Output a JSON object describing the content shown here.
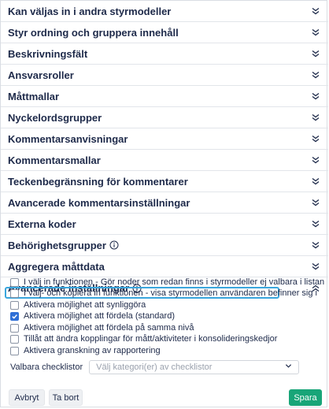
{
  "accordion": [
    {
      "label": "Kan väljas in i andra styrmodeller",
      "expanded": false,
      "info": false
    },
    {
      "label": "Styr ordning och gruppera innehåll",
      "expanded": false,
      "info": false
    },
    {
      "label": "Beskrivningsfält",
      "expanded": false,
      "info": false
    },
    {
      "label": "Ansvarsroller",
      "expanded": false,
      "info": false
    },
    {
      "label": "Måttmallar",
      "expanded": false,
      "info": false
    },
    {
      "label": "Nyckelordsgrupper",
      "expanded": false,
      "info": false
    },
    {
      "label": "Kommentarsanvisningar",
      "expanded": false,
      "info": false
    },
    {
      "label": "Kommentarsmallar",
      "expanded": false,
      "info": false
    },
    {
      "label": "Teckenbegränsning för kommentarer",
      "expanded": false,
      "info": false
    },
    {
      "label": "Avancerade kommentarsinställningar",
      "expanded": false,
      "info": false
    },
    {
      "label": "Externa koder",
      "expanded": false,
      "info": false
    },
    {
      "label": "Behörighetsgrupper",
      "expanded": false,
      "info": true
    },
    {
      "label": "Aggregera måttdata",
      "expanded": false,
      "info": false
    },
    {
      "label": "Avancerade inställningar",
      "expanded": true,
      "info": true
    }
  ],
  "advanced": {
    "options": [
      {
        "label": "I välj in funktionen - Gör noder som redan finns i styrmodeller ej valbara i listan",
        "checked": false
      },
      {
        "label": "I välj- och kopiera in funktionen - visa styrmodellen användaren befinner sig i",
        "checked": false
      },
      {
        "label": "Aktivera möjlighet att synliggöra",
        "checked": false
      },
      {
        "label": "Aktivera möjlighet att fördela (standard)",
        "checked": true
      },
      {
        "label": "Aktivera möjlighet att fördela på samma nivå",
        "checked": false
      },
      {
        "label": "Tillåt att ändra kopplingar för mått/aktiviteter i konsolideringskedjor",
        "checked": false
      },
      {
        "label": "Aktivera granskning av rapportering",
        "checked": false
      }
    ],
    "checklist_label": "Valbara checklistor",
    "checklist_placeholder": "Välj kategori(er) av checklistor"
  },
  "buttons": {
    "cancel": "Avbryt",
    "delete": "Ta bort",
    "save": "Spara"
  },
  "colors": {
    "text": "#1e2a4a",
    "checkbox_checked": "#2f6fd6",
    "highlight": "#3aa6dd",
    "save_button": "#18a578"
  }
}
